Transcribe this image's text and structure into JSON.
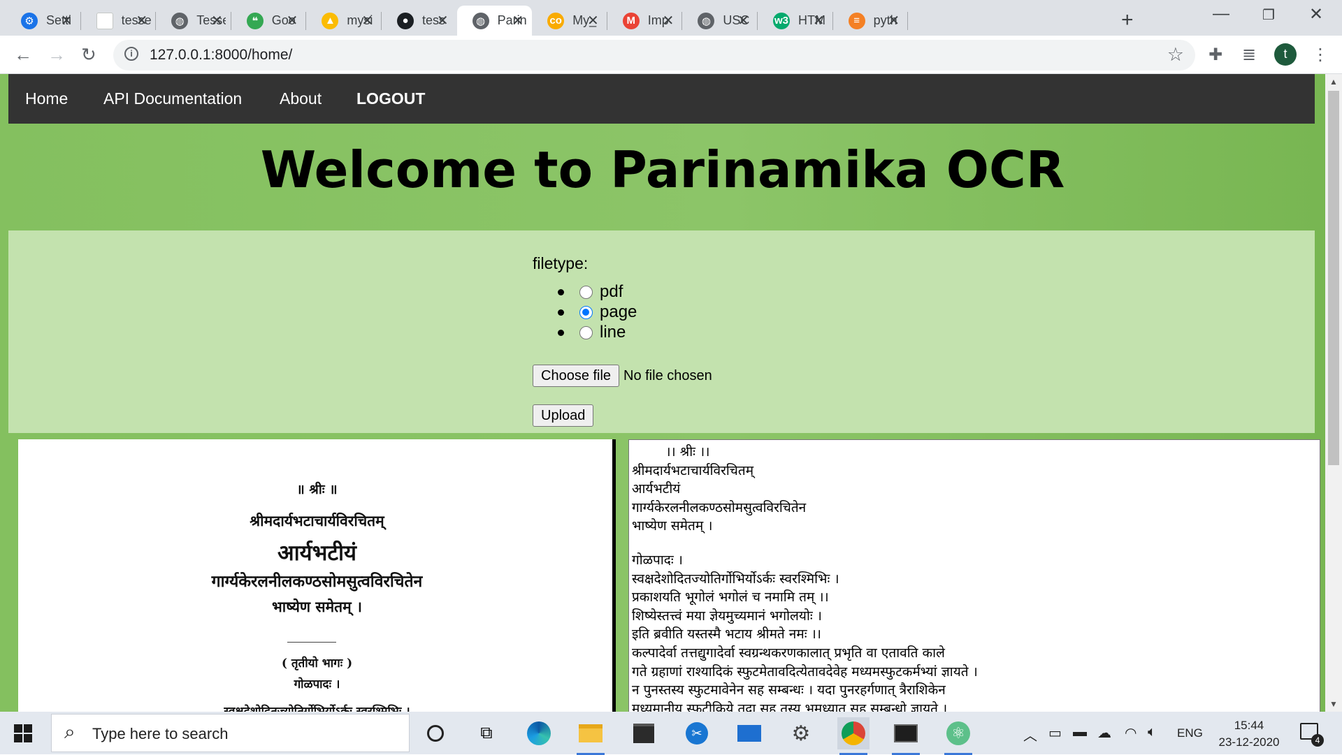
{
  "browser": {
    "tabs": [
      {
        "title": "Setti",
        "icon": "gear-icon",
        "color": "#1a73e8",
        "glyph": "⚙"
      },
      {
        "title": "tesse",
        "icon": "page-icon",
        "color": "#ffffff",
        "glyph": ""
      },
      {
        "title": "Tesse",
        "icon": "globe-icon",
        "color": "#5f6368",
        "glyph": "◍"
      },
      {
        "title": "Goo",
        "icon": "keep-icon",
        "color": "#34a853",
        "glyph": "❝"
      },
      {
        "title": "mysi",
        "icon": "drive-icon",
        "color": "#fbbc04",
        "glyph": "▲"
      },
      {
        "title": "tess",
        "icon": "github-icon",
        "color": "#1b1f23",
        "glyph": "●"
      },
      {
        "title": "Parin",
        "icon": "globe-icon",
        "color": "#5f6368",
        "glyph": "◍"
      },
      {
        "title": "My_",
        "icon": "colab-icon",
        "color": "#f9ab00",
        "glyph": "co"
      },
      {
        "title": "Imp",
        "icon": "gmail-icon",
        "color": "#ea4335",
        "glyph": "M"
      },
      {
        "title": "USC",
        "icon": "globe-icon",
        "color": "#5f6368",
        "glyph": "◍"
      },
      {
        "title": "HTM",
        "icon": "w3schools-icon",
        "color": "#04aa6d",
        "glyph": "w3"
      },
      {
        "title": "pyth",
        "icon": "stackoverflow-icon",
        "color": "#f48024",
        "glyph": "≡"
      }
    ],
    "active_tab_index": 6,
    "url": "127.0.0.1:8000/home/",
    "profile_initial": "t"
  },
  "nav": {
    "home": "Home",
    "api_docs": "API Documentation",
    "about": "About",
    "logout": "LOGOUT"
  },
  "heading": "Welcome to Parinamika OCR",
  "form": {
    "filetype_label": "filetype:",
    "options": [
      {
        "label": "pdf",
        "checked": false
      },
      {
        "label": "page",
        "checked": true
      },
      {
        "label": "line",
        "checked": false
      }
    ],
    "choose_file": "Choose file",
    "no_file": "No file chosen",
    "upload": "Upload"
  },
  "scan_image": {
    "lines": [
      "॥ श्रीः ॥",
      "श्रीमदार्यभटाचार्यविरचितम्",
      "आर्यभटीयं",
      "गार्ग्यकेरलनीलकण्ठसोमसुत्वविरचितेन",
      "भाष्येण समेतम् ।",
      "( तृतीयो भागः )",
      "गोळपादः ।",
      "स्वक्षदेशोदितज्योतिर्गोभिर्योऽर्कः स्वरश्मिभिः ।"
    ]
  },
  "ocr_output": {
    "block1": [
      "        ।। श्रीः ।।",
      "श्रीमदार्यभटाचार्यविरचितम्",
      "आर्यभटीयं",
      "गार्ग्यकेरलनीलकण्ठसोमसुत्वविरचितेन",
      "भाष्येण समेतम् ।"
    ],
    "block2": [
      "गोळपादः ।",
      "स्वक्षदेशोदितज्योतिर्गोभिर्योऽर्कः स्वरश्मिभिः ।",
      "प्रकाशयति भूगोलं भगोलं च नमामि तम् ।।",
      "शिष्येस्तत्त्वं मया ज्ञेयमुच्यमानं भगोलयोः ।",
      "इति ब्रवीति यस्तस्मै भटाय श्रीमते नमः ।।",
      "कल्पादेर्वा तत्तद्युगादेर्वा स्वग्रन्थकरणकालात् प्रभृति वा एतावति काले",
      "गते ग्रहाणां राश्यादिकं स्फुटमेतावदित्येतावदेवेह मध्यमस्फुटकर्मभ्यां ज्ञायते ।",
      "न पुनस्तस्य स्फुटमावेनेन सह सम्बन्धः । यदा पुनरहर्गणात् त्रैराशिकेन",
      "मध्यमानीय स्फुटीकिये तदा सह तस्य भूमध्यात् सह सम्बन्धो ज्ञायते ।"
    ]
  },
  "taskbar": {
    "search_placeholder": "Type here to search",
    "language": "ENG",
    "time": "15:44",
    "date": "23-12-2020",
    "notification_count": "4"
  }
}
